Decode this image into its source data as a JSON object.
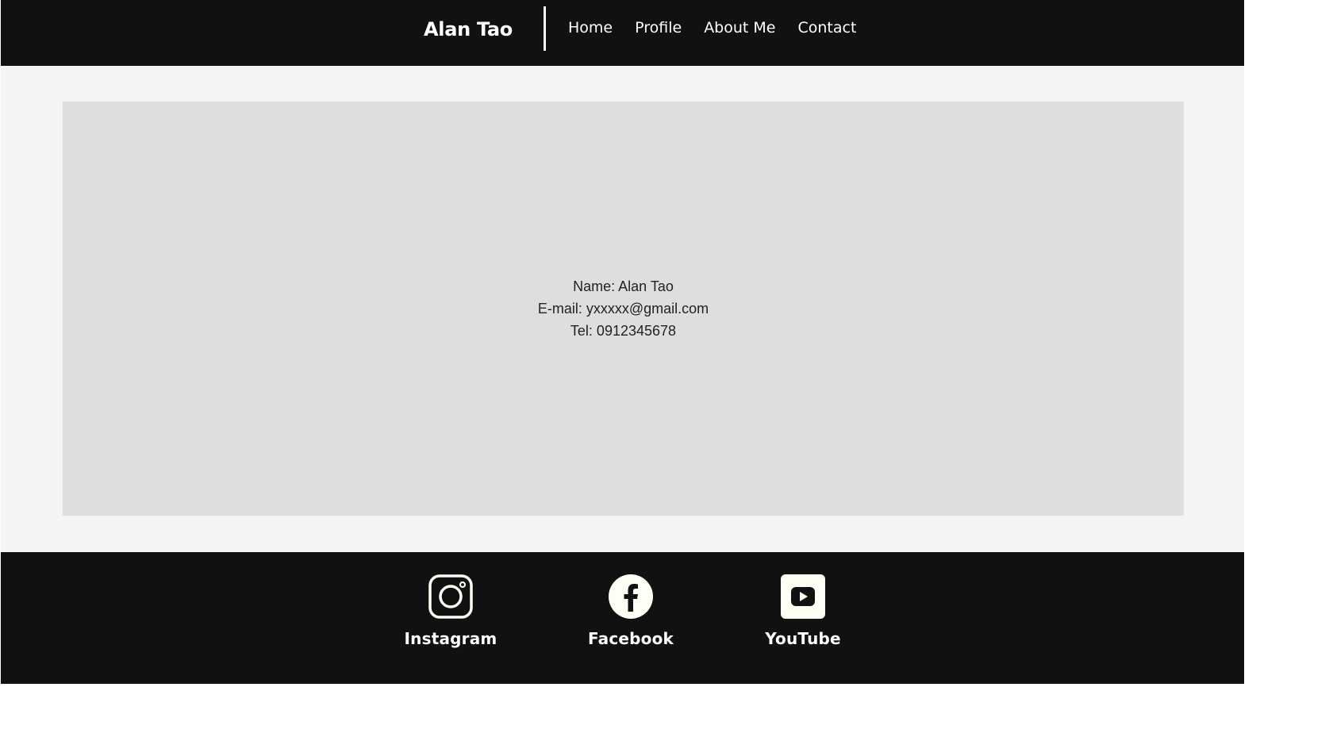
{
  "header": {
    "brand": "Alan Tao",
    "nav": [
      {
        "label": "Home"
      },
      {
        "label": "Profile"
      },
      {
        "label": "About Me"
      },
      {
        "label": "Contact"
      }
    ]
  },
  "contact": {
    "name_line": "Name: Alan Tao",
    "email_line": "E-mail: yxxxxx@gmail.com",
    "tel_line": "Tel: 0912345678"
  },
  "footer": {
    "socials": [
      {
        "label": "Instagram",
        "icon": "instagram-icon"
      },
      {
        "label": "Facebook",
        "icon": "facebook-icon"
      },
      {
        "label": "YouTube",
        "icon": "youtube-icon"
      }
    ]
  },
  "colors": {
    "header_bg": "#111111",
    "main_bg": "#f4f4f4",
    "card_bg": "#dedede",
    "footer_bg": "#111111",
    "text_light": "#ffffff",
    "text_dark": "#222222",
    "icon_fill": "#fffef5"
  }
}
